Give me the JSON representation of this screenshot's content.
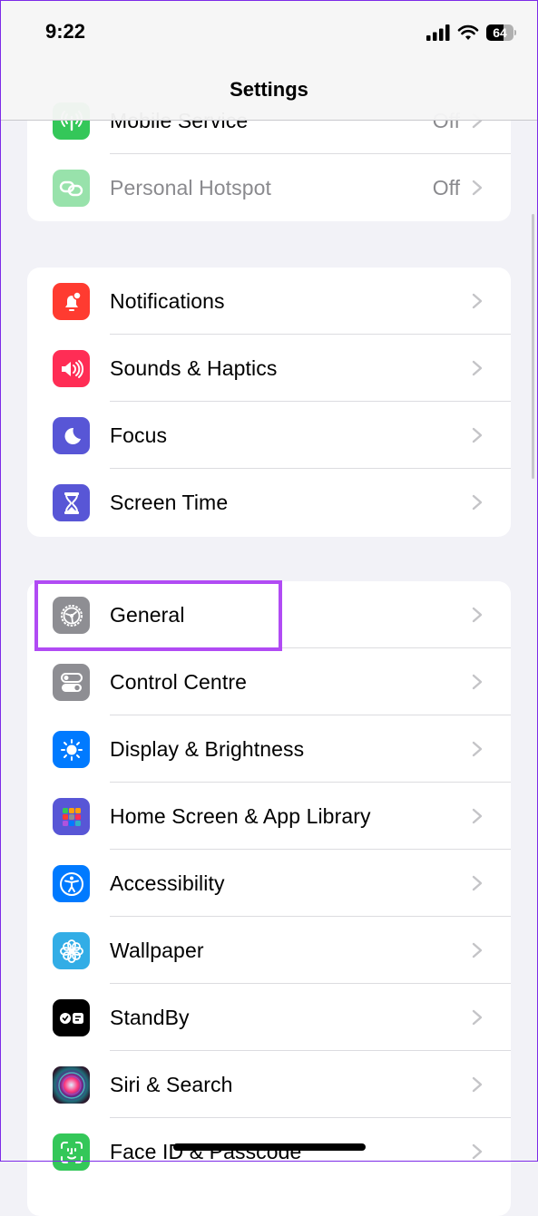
{
  "status_bar": {
    "time": "9:22",
    "battery_level": "64",
    "battery_percent": 64,
    "signal_bars": 4,
    "wifi": "connected"
  },
  "nav": {
    "title": "Settings"
  },
  "highlight_color": "#b14bf4",
  "groups": [
    {
      "items": [
        {
          "label": "Mobile Service",
          "value": "Off",
          "icon": "antenna-icon",
          "color": "#34c759"
        },
        {
          "label": "Personal Hotspot",
          "value": "Off",
          "icon": "link-icon",
          "color": "#34c759",
          "disabled": true
        }
      ]
    },
    {
      "items": [
        {
          "label": "Notifications",
          "icon": "bell-icon",
          "color": "#ff3b30"
        },
        {
          "label": "Sounds & Haptics",
          "icon": "speaker-icon",
          "color": "#ff2d55"
        },
        {
          "label": "Focus",
          "icon": "moon-icon",
          "color": "#5856d6"
        },
        {
          "label": "Screen Time",
          "icon": "hourglass-icon",
          "color": "#5856d6"
        }
      ]
    },
    {
      "items": [
        {
          "label": "General",
          "icon": "gear-icon",
          "color": "#8e8e93",
          "highlighted": true
        },
        {
          "label": "Control Centre",
          "icon": "toggles-icon",
          "color": "#8e8e93"
        },
        {
          "label": "Display & Brightness",
          "icon": "sun-icon",
          "color": "#007aff"
        },
        {
          "label": "Home Screen & App Library",
          "icon": "app-grid-icon",
          "color": "#5856d6"
        },
        {
          "label": "Accessibility",
          "icon": "accessibility-icon",
          "color": "#007aff"
        },
        {
          "label": "Wallpaper",
          "icon": "flower-icon",
          "color": "#32ade6"
        },
        {
          "label": "StandBy",
          "icon": "standby-icon",
          "color": "#000000"
        },
        {
          "label": "Siri & Search",
          "icon": "siri-icon",
          "color": "#1c1c1e"
        },
        {
          "label": "Face ID & Passcode",
          "icon": "face-id-icon",
          "color": "#34c759"
        }
      ]
    }
  ]
}
